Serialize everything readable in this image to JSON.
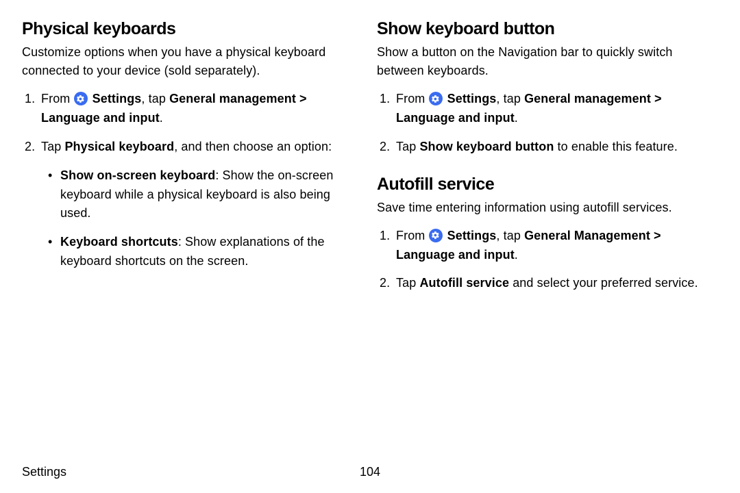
{
  "left": {
    "h1": "Physical keyboards",
    "intro": "Customize options when you have a physical keyboard connected to your device (sold separately).",
    "s1_pre": "From ",
    "s1_settings": "Settings",
    "s1_mid": ", tap ",
    "s1_gm": "General management",
    "s1_ar": " > ",
    "s1_li": "Language and input",
    "s1_end": ".",
    "s2_pre": "Tap ",
    "s2_pk": "Physical keyboard",
    "s2_post": ", and then choose an option:",
    "b1_t": "Show on-screen keyboard",
    "b1_r": ": Show the on-screen keyboard while a physical keyboard is also being used.",
    "b2_t": "Keyboard shortcuts",
    "b2_r": ": Show explanations of the keyboard shortcuts on the screen."
  },
  "rightA": {
    "h1": "Show keyboard button",
    "intro": "Show a button on the Navigation bar to quickly switch between keyboards.",
    "s1_pre": "From ",
    "s1_settings": "Settings",
    "s1_mid": ", tap ",
    "s1_gm": "General management",
    "s1_ar": " > ",
    "s1_li": "Language and input",
    "s1_end": ".",
    "s2_pre": "Tap ",
    "s2_skb": "Show keyboard button",
    "s2_post": " to enable this feature."
  },
  "rightB": {
    "h1": "Autofill service",
    "intro": "Save time entering information using autofill services.",
    "s1_pre": "From ",
    "s1_settings": "Settings",
    "s1_mid": ", tap ",
    "s1_gm": "General Management",
    "s1_ar": " > ",
    "s1_li": "Language and input",
    "s1_end": ".",
    "s2_pre": "Tap ",
    "s2_af": "Autofill service",
    "s2_post": " and select your preferred service."
  },
  "footer": {
    "section": "Settings",
    "page": "104"
  }
}
